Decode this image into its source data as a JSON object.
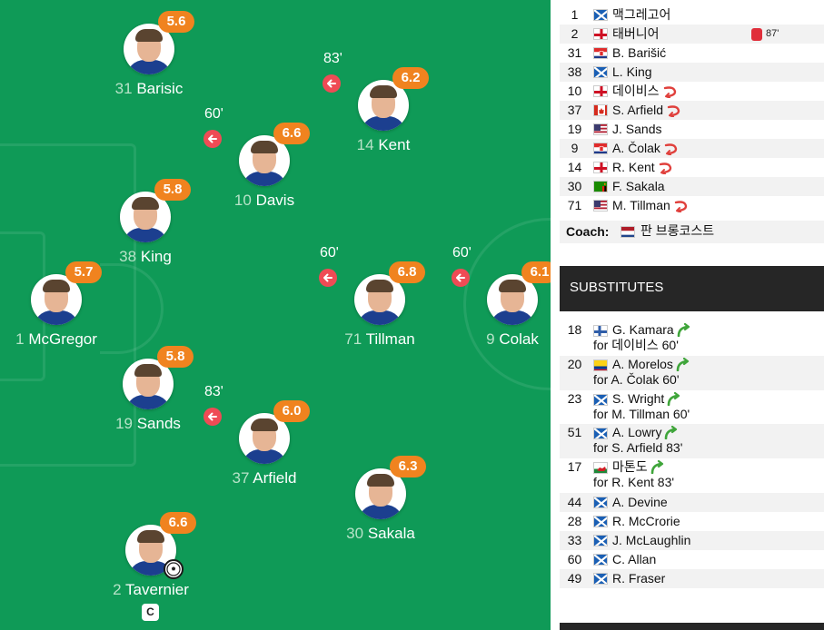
{
  "pitch": {
    "players": [
      {
        "number": "31",
        "name": "Barisic",
        "rating": "5.6"
      },
      {
        "number": "10",
        "name": "Davis",
        "rating": "6.6",
        "sub_minute": "60'"
      },
      {
        "number": "14",
        "name": "Kent",
        "rating": "6.2",
        "sub_minute": "83'"
      },
      {
        "number": "38",
        "name": "King",
        "rating": "5.8"
      },
      {
        "number": "1",
        "name": "McGregor",
        "rating": "5.7"
      },
      {
        "number": "71",
        "name": "Tillman",
        "rating": "6.8",
        "sub_minute": "60'"
      },
      {
        "number": "9",
        "name": "Colak",
        "rating": "6.1",
        "sub_minute": "60'"
      },
      {
        "number": "19",
        "name": "Sands",
        "rating": "5.8"
      },
      {
        "number": "37",
        "name": "Arfield",
        "rating": "6.0",
        "sub_minute": "83'"
      },
      {
        "number": "30",
        "name": "Sakala",
        "rating": "6.3"
      },
      {
        "number": "2",
        "name": "Tavernier",
        "rating": "6.6",
        "captain_badge": "C",
        "scored": true
      }
    ]
  },
  "lineup": {
    "players": [
      {
        "number": "1",
        "name": "맥그레고어",
        "flag": "scotland"
      },
      {
        "number": "2",
        "name": "태버니어",
        "flag": "england",
        "card_minute": "87'"
      },
      {
        "number": "31",
        "name": "B. Barišić",
        "flag": "croatia"
      },
      {
        "number": "38",
        "name": "L. King",
        "flag": "scotland"
      },
      {
        "number": "10",
        "name": "데이비스",
        "flag": "england",
        "subbed_off": true
      },
      {
        "number": "37",
        "name": "S. Arfield",
        "flag": "canada",
        "subbed_off": true
      },
      {
        "number": "19",
        "name": "J. Sands",
        "flag": "usa"
      },
      {
        "number": "9",
        "name": "A. Čolak",
        "flag": "croatia",
        "subbed_off": true
      },
      {
        "number": "14",
        "name": "R. Kent",
        "flag": "england",
        "subbed_off": true
      },
      {
        "number": "30",
        "name": "F. Sakala",
        "flag": "zambia"
      },
      {
        "number": "71",
        "name": "M. Tillman",
        "flag": "usa",
        "subbed_off": true
      }
    ],
    "coach_label": "Coach:",
    "coach_name": "판 브롱코스트",
    "coach_flag": "netherlands"
  },
  "substitutes": {
    "title": "SUBSTITUTES",
    "players": [
      {
        "number": "18",
        "name": "G. Kamara",
        "flag": "finland",
        "subbed_on": true,
        "replaced": "for 데이비스 60'"
      },
      {
        "number": "20",
        "name": "A. Morelos",
        "flag": "colombia",
        "subbed_on": true,
        "replaced": "for A. Čolak 60'"
      },
      {
        "number": "23",
        "name": "S. Wright",
        "flag": "scotland",
        "subbed_on": true,
        "replaced": "for M. Tillman 60'"
      },
      {
        "number": "51",
        "name": "A. Lowry",
        "flag": "scotland",
        "subbed_on": true,
        "replaced": "for S. Arfield 83'"
      },
      {
        "number": "17",
        "name": "마톤도",
        "flag": "wales",
        "subbed_on": true,
        "replaced": "for R. Kent 83'"
      },
      {
        "number": "44",
        "name": "A. Devine",
        "flag": "scotland"
      },
      {
        "number": "28",
        "name": "R. McCrorie",
        "flag": "scotland"
      },
      {
        "number": "33",
        "name": "J. McLaughlin",
        "flag": "scotland"
      },
      {
        "number": "60",
        "name": "C. Allan",
        "flag": "scotland"
      },
      {
        "number": "49",
        "name": "R. Fraser",
        "flag": "scotland"
      }
    ]
  },
  "colors": {
    "pitch": "#0f9a57",
    "rating_badge": "#f0831f",
    "sub_off": "#ef4b55",
    "sub_off_arrow": "#e0403c",
    "sub_on_arrow": "#3fa53a",
    "header_dark": "#262626",
    "red_card": "#e02f3b"
  },
  "icons": {
    "sub_off": "sub-off-arrow-icon",
    "sub_on": "sub-on-arrow-icon",
    "goal": "football-icon",
    "red_card": "red-card-icon"
  }
}
